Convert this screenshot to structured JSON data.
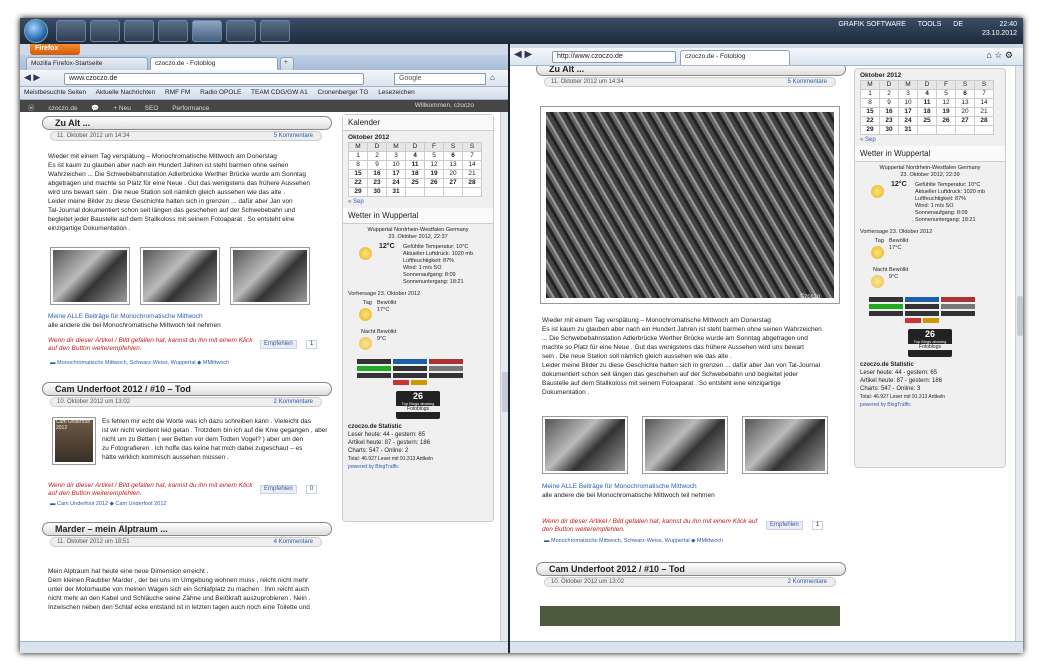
{
  "taskbar": {
    "app_name": "GRAFIK SOFTWARE",
    "tools": "TOOLS",
    "lang": "DE",
    "time": "22:40",
    "date": "23.10.2012"
  },
  "left": {
    "firefox_label": "Firefox",
    "tabs": [
      "Mozilla Firefox-Startseite",
      "czoczo.de - Fotoblog"
    ],
    "url": "www.czoczo.de",
    "search_placeholder": "Google",
    "bookmarks": [
      "Meistbesuchte Seiten",
      "Aktuelle Nachrichten",
      "RMF FM",
      "Radio OPOLE",
      "TEAM CDG/GW A1",
      "Cronenberger TG",
      "Lesezeichen"
    ],
    "wpbar": {
      "site": "czoczo.de",
      "new": "+ Neu",
      "seo": "SEO",
      "perf": "Performance",
      "welcome": "Willkommen, czoczo"
    },
    "posts": [
      {
        "title": "Zu Alt ...",
        "date": "11. Oktober 2012 um 14:34",
        "comments": "5 Kommentare",
        "text": [
          "Wieder mit einem Tag verspätung – Monochromatische Mittwoch am Donerstag",
          "Es ist kaum zu glauben aber nach ein Hundert Jahren ist steht barmen ohne seinen",
          "Wahrzeichen ... Die Schwebebahnstation Adlerbrücke Werther Brücke wurde am Sonntag",
          "abgetragen und machte so Platz für eine Neue . Gut das wenigstens das frühere Aussehen",
          "wird uns bewart sein . Die neue Station soll nämlich gleich aussehen wie das alte .",
          "Leider meine Bilder zu diese Geschichte halten sich in grenzen ... dafür aber Jan von",
          "Tal-Journal dokumentiert schon seit längen das geschehen auf der Schwebebahn und",
          "begleitet jeder Baustelle auf dem Stallkoloss mit seinem Fotoaparat . So entsteht eine",
          "einzigartige Dokumentation ."
        ],
        "more1": "Meine ALLE Beiträge für Monochromatische Mittwoch",
        "more2": "alle andere die bei Monochromatische Mittwoch teil nehmen",
        "red": "Wenn dir dieser Artikel / Bild gefallen hat, kannst du ihn mit einem Klick auf den Button weiterempfehlen.",
        "fb": "Empfehlen",
        "fbcount": "1",
        "tags": "Monochromatische Mittwoch, Schwarz-Weiss, Wuppertal",
        "tag2": "MMittwoch"
      },
      {
        "title": "Cam Underfoot 2012 / #10 – Tod",
        "date": "10. Oktober 2012 um 13:02",
        "comments": "2 Kommentare",
        "thumb_caption": "Cam Underfoot 2012",
        "text": [
          "Es fehlen mir echt die Worte was ich dazu schreiben kann . Vieleicht das",
          "ist wir nicht verdient leid getan . Trotzdem bin ich auf die Knie gegangen , aber",
          "nicht um zu Betten ( wer Betten vor dem Todten Vogel? ) aber um den",
          "zu Fotografieren . Ich hoffe das keine hat mich dabei zugeschaut – es",
          "hätte wirklich kommisch aussehen müssen ."
        ],
        "red": "Wenn dir dieser Artikel / Bild gefallen hat, kannst du ihn mit einem Klick auf den Button weiterempfehlen.",
        "fb": "Empfehlen",
        "fbcount": "0",
        "tags": "Cam Underfoot 2012",
        "tag2": "Cam Underfoot 2012"
      },
      {
        "title": "Marder – mein Alptraum ...",
        "date": "11. Oktober 2012 um 18:51",
        "comments": "4 Kommentare",
        "text": [
          "Mein Alptraum hat heute eine neue Dimension erreicht .",
          "Dem kleinen Raubtier Marder , der bei uns im Umgebung wohnen muss , reicht nicht mehr",
          "unter der Motorhaube von meinen Wagen sich ein Schlafplatz zu machen . Ihm reicht auch",
          "nicht mehr an den Kabel und Schläuche seine Zähne und Beißkraft auszuprobieren . Nein .",
          "Inzwischen neben den Schlaf ecke entstand ist in letzten tagen auch noch eine Toilette und"
        ]
      }
    ],
    "sidebar": {
      "kal_title": "Kalender",
      "month": "Oktober 2012",
      "days": [
        "M",
        "D",
        "M",
        "D",
        "F",
        "S",
        "S"
      ],
      "weeks": [
        [
          "1",
          "2",
          "3",
          "4",
          "5",
          "6",
          "7"
        ],
        [
          "8",
          "9",
          "10",
          "11",
          "12",
          "13",
          "14"
        ],
        [
          "15",
          "16",
          "17",
          "18",
          "19",
          "20",
          "21"
        ],
        [
          "22",
          "23",
          "24",
          "25",
          "26",
          "27",
          "28"
        ],
        [
          "29",
          "30",
          "31",
          "",
          "",
          "",
          ""
        ]
      ],
      "prev": "« Sep",
      "wx_title": "Wetter in Wuppertal",
      "wx_loc": "Wuppertal Nordrhein-Westfalen Germany",
      "wx_date": "23. Oktober 2012, 22:37",
      "temp": "12°C",
      "wx_lines": [
        "Gefühlte Temperatur: 10°C",
        "Aktueller Luftdruck: 1020 mb",
        "Luftfeuchtigkeit: 87%",
        "Wind: 1 m/s SO",
        "Sonnenaufgang: 8:09",
        "Sonnenuntergang: 18:21"
      ],
      "forecast": "Vorhersage 23. Oktober 2012",
      "day": "Tag",
      "day_w": "Bewölkt",
      "day_t": "17°C",
      "night": "Nacht",
      "night_w": "Bewölkt",
      "night_t": "9°C",
      "rank": "26",
      "rank_label": "Top Blogs abusing",
      "rank_sub": "Fotoblogs",
      "stat_title": "czoczo.de Statistic",
      "stat_lines": [
        "Leser heute: 44 - gestern: 65",
        "Artikel heute: 87 - gestern: 186",
        "Charts: 547 - Online: 2",
        "Total: 46.927 Leser mit 91.313 Artikeln",
        "powered by BlogTraffic"
      ]
    }
  },
  "right": {
    "tabs": [
      "http://www.czoczo.de",
      "czoczo.de - Fotoblog"
    ],
    "post1": {
      "title": "Zu Alt ...",
      "date": "11. Oktober 2012 um 14:34",
      "comments": "5 Kommentare",
      "text": [
        "Wieder mit einem Tag verspätung – Monochromatische Mittwoch am Donerstag",
        "Es ist kaum zu glauben aber nach ein Hundert Jahren ist steht barmen ohne seinen Wahrzeichen",
        "... Die Schwebebahnstation Adlerbrücke Werther Brücke wurde am Sonntag abgetragen und",
        "machte so Platz für eine Neue . Gut das wenigstens das frühere Aussehen wird uns bewart",
        "sein . Die neue Station soll nämlich gleich aussehen wie das alte .",
        "Leider meine Bilder zu diese Geschichte halten sich in grenzen ... dafür aber Jan von Tal-Journal",
        "dokumentiert schon seit längen das geschehen auf der Schwebebahn und begleitet jeder",
        "Baustelle auf dem Stallkoloss mit seinem Fotoaparat . So entsteht eine einzigartige",
        "Dokumentation ."
      ],
      "more1": "Meine ALLE Beiträge für Monochromatische Mittwoch",
      "more2": "alle andere die bei Monochromatische Mittwoch teil nehmen",
      "red": "Wenn dir dieser Artikel / Bild gefallen hat, kannst du ihn mit einem Klick auf den Button weiterempfehlen.",
      "fb": "Empfehlen",
      "fbcount": "1",
      "tags": "Monochromatische Mittwoch, Schwarz-Weiss, Wuppertal",
      "tag2": "MMittwoch",
      "watermark": "©zoczo"
    },
    "post2": {
      "title": "Cam Underfoot 2012 / #10 – Tod",
      "date": "10. Oktober 2012 um 13:02",
      "comments": "2 Kommentare"
    },
    "sidebar": {
      "month": "Oktober 2012",
      "wx_title": "Wetter in Wuppertal",
      "wx_loc": "Wuppertal Nordrhein-Westfalen Germany",
      "wx_date": "23. Oktober 2012, 22:39",
      "stat_title": "czoczo.de Statistic",
      "stat_lines": [
        "Leser heute: 44 - gestern: 65",
        "Artikel heute: 87 - gestern: 186",
        "Charts: 547 - Online: 3",
        "Total: 46.927 Leser mit 91.313 Artikeln",
        "powered by BlogTraffic"
      ]
    }
  }
}
